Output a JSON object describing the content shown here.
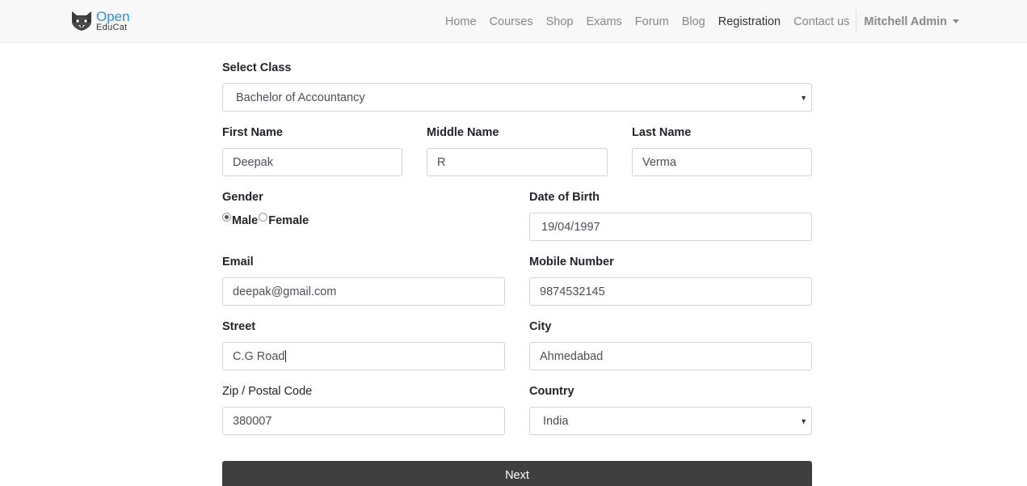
{
  "brand": {
    "line1": "Open",
    "line2": "EduCat"
  },
  "nav": {
    "items": [
      "Home",
      "Courses",
      "Shop",
      "Exams",
      "Forum",
      "Blog",
      "Registration",
      "Contact us"
    ],
    "active": "Registration",
    "user": "Mitchell Admin"
  },
  "form": {
    "select_class": {
      "label": "Select Class",
      "value": "Bachelor of Accountancy"
    },
    "first_name": {
      "label": "First Name",
      "value": "Deepak"
    },
    "middle_name": {
      "label": "Middle Name",
      "value": "R"
    },
    "last_name": {
      "label": "Last Name",
      "value": "Verma"
    },
    "gender": {
      "label": "Gender",
      "options": [
        "Male",
        "Female"
      ],
      "selected": "Male"
    },
    "dob": {
      "label": "Date of Birth",
      "value": "19/04/1997"
    },
    "email": {
      "label": "Email",
      "value": "deepak@gmail.com"
    },
    "mobile": {
      "label": "Mobile Number",
      "value": "9874532145"
    },
    "street": {
      "label": "Street",
      "value": "C.G Road"
    },
    "city": {
      "label": "City",
      "value": "Ahmedabad"
    },
    "zip": {
      "label": "Zip / Postal Code",
      "value": "380007"
    },
    "country": {
      "label": "Country",
      "value": "India"
    },
    "next_label": "Next"
  }
}
